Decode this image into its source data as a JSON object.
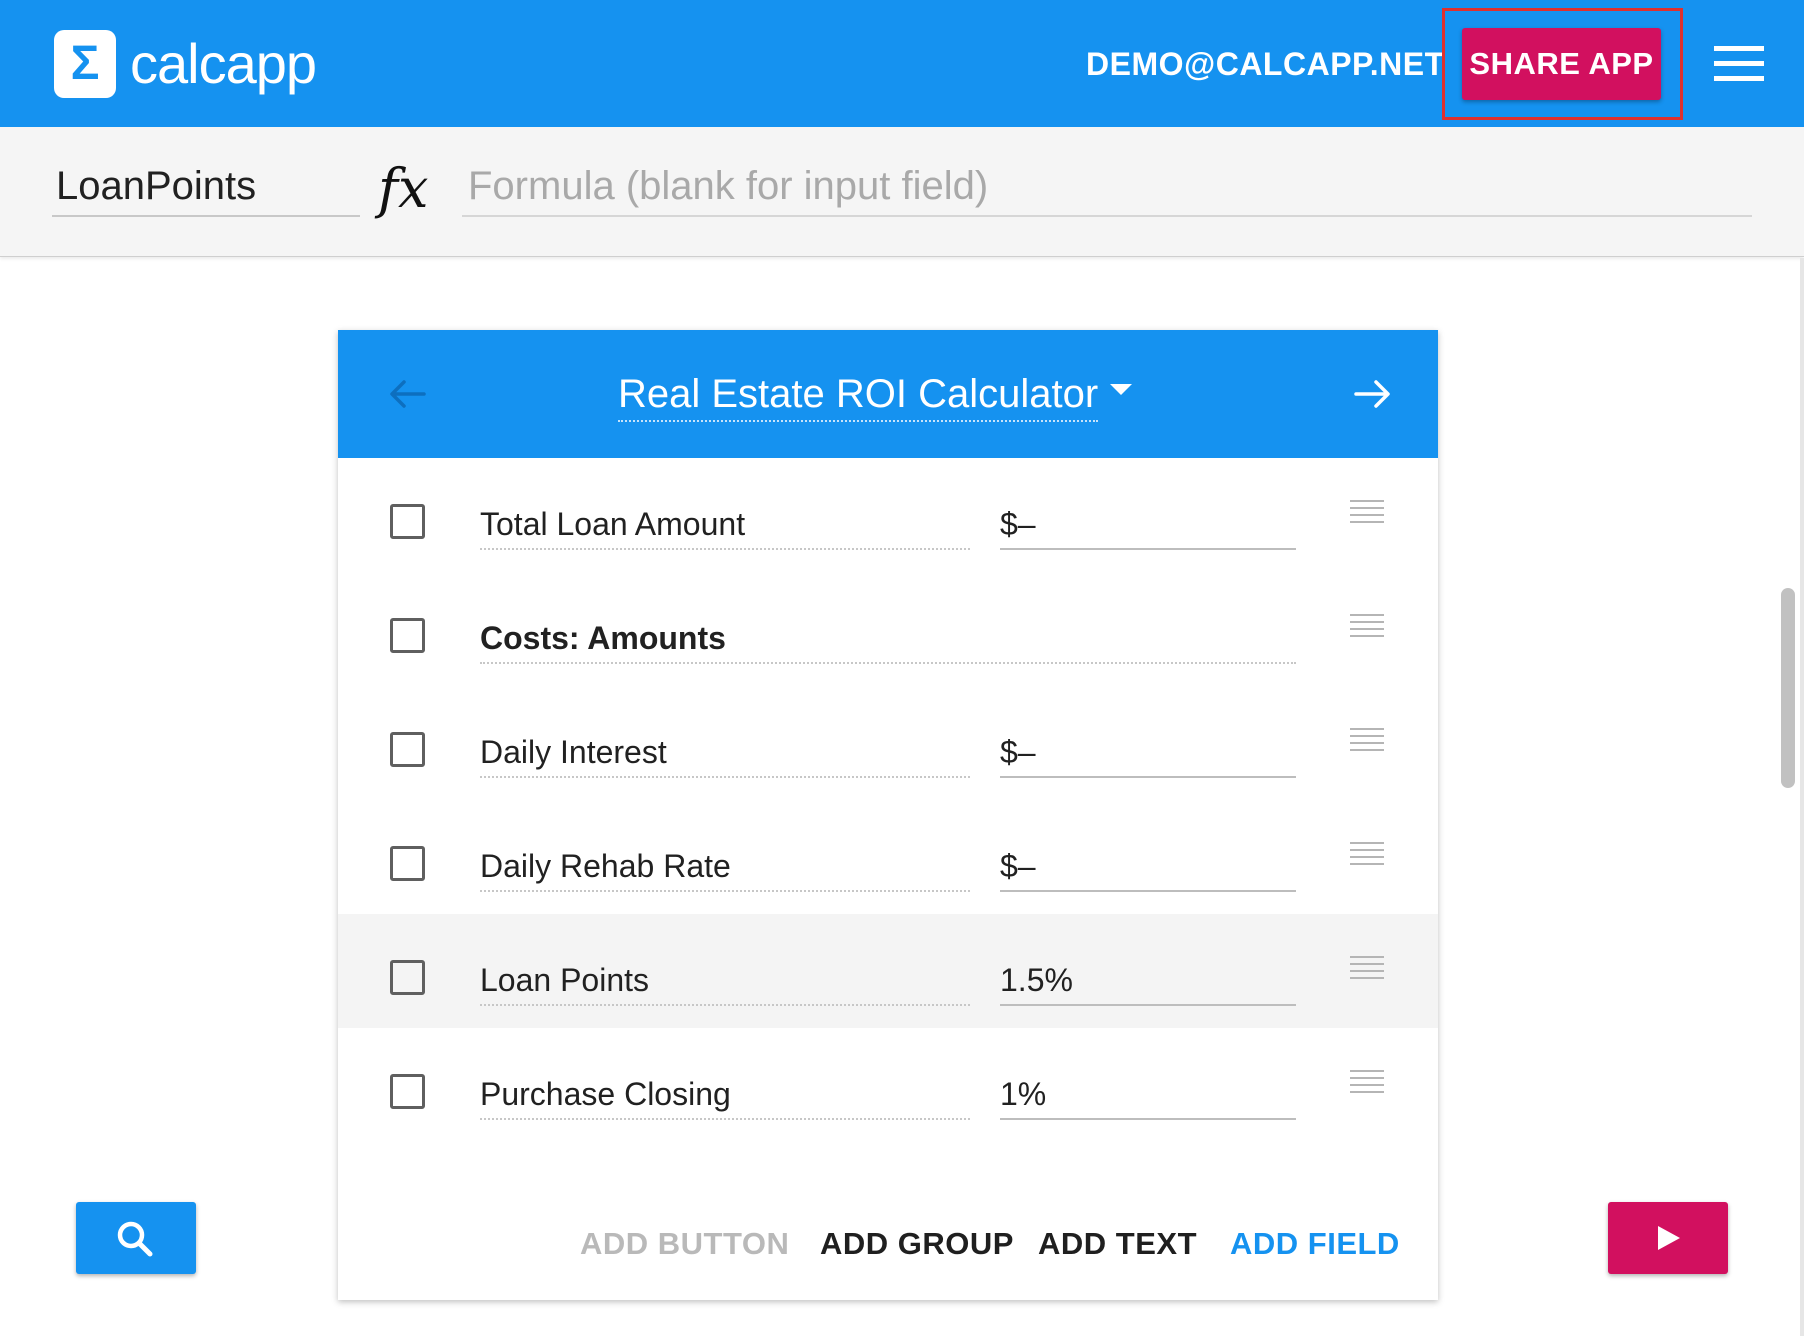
{
  "topbar": {
    "brand": "calcapp",
    "logo_glyph": "Σ",
    "account_email": "DEMO@CALCAPP.NET",
    "share_label": "SHARE APP",
    "bar_color": "#1592f0",
    "share_color": "#d2105f"
  },
  "formula_bar": {
    "name_value": "LoanPoints",
    "fx_label": "fx",
    "formula_placeholder": "Formula (blank for input field)",
    "formula_value": ""
  },
  "card": {
    "title": "Real Estate ROI Calculator",
    "rows": [
      {
        "label": "Total Loan Amount",
        "value": "$–",
        "type": "field"
      },
      {
        "label": "Costs: Amounts",
        "value": "",
        "type": "group"
      },
      {
        "label": "Daily Interest",
        "value": "$–",
        "type": "field"
      },
      {
        "label": "Daily Rehab Rate",
        "value": "$–",
        "type": "field"
      },
      {
        "label": "Loan Points",
        "value": "1.5%",
        "type": "field",
        "selected": true
      },
      {
        "label": "Purchase Closing",
        "value": "1%",
        "type": "field"
      }
    ],
    "actions": {
      "add_button": "ADD BUTTON",
      "add_group": "ADD GROUP",
      "add_text": "ADD TEXT",
      "add_field": "ADD FIELD"
    }
  },
  "icons": {
    "search": "search-icon",
    "play": "play-icon",
    "menu": "hamburger-menu-icon",
    "back": "arrow-left-icon",
    "forward": "arrow-right-icon"
  }
}
